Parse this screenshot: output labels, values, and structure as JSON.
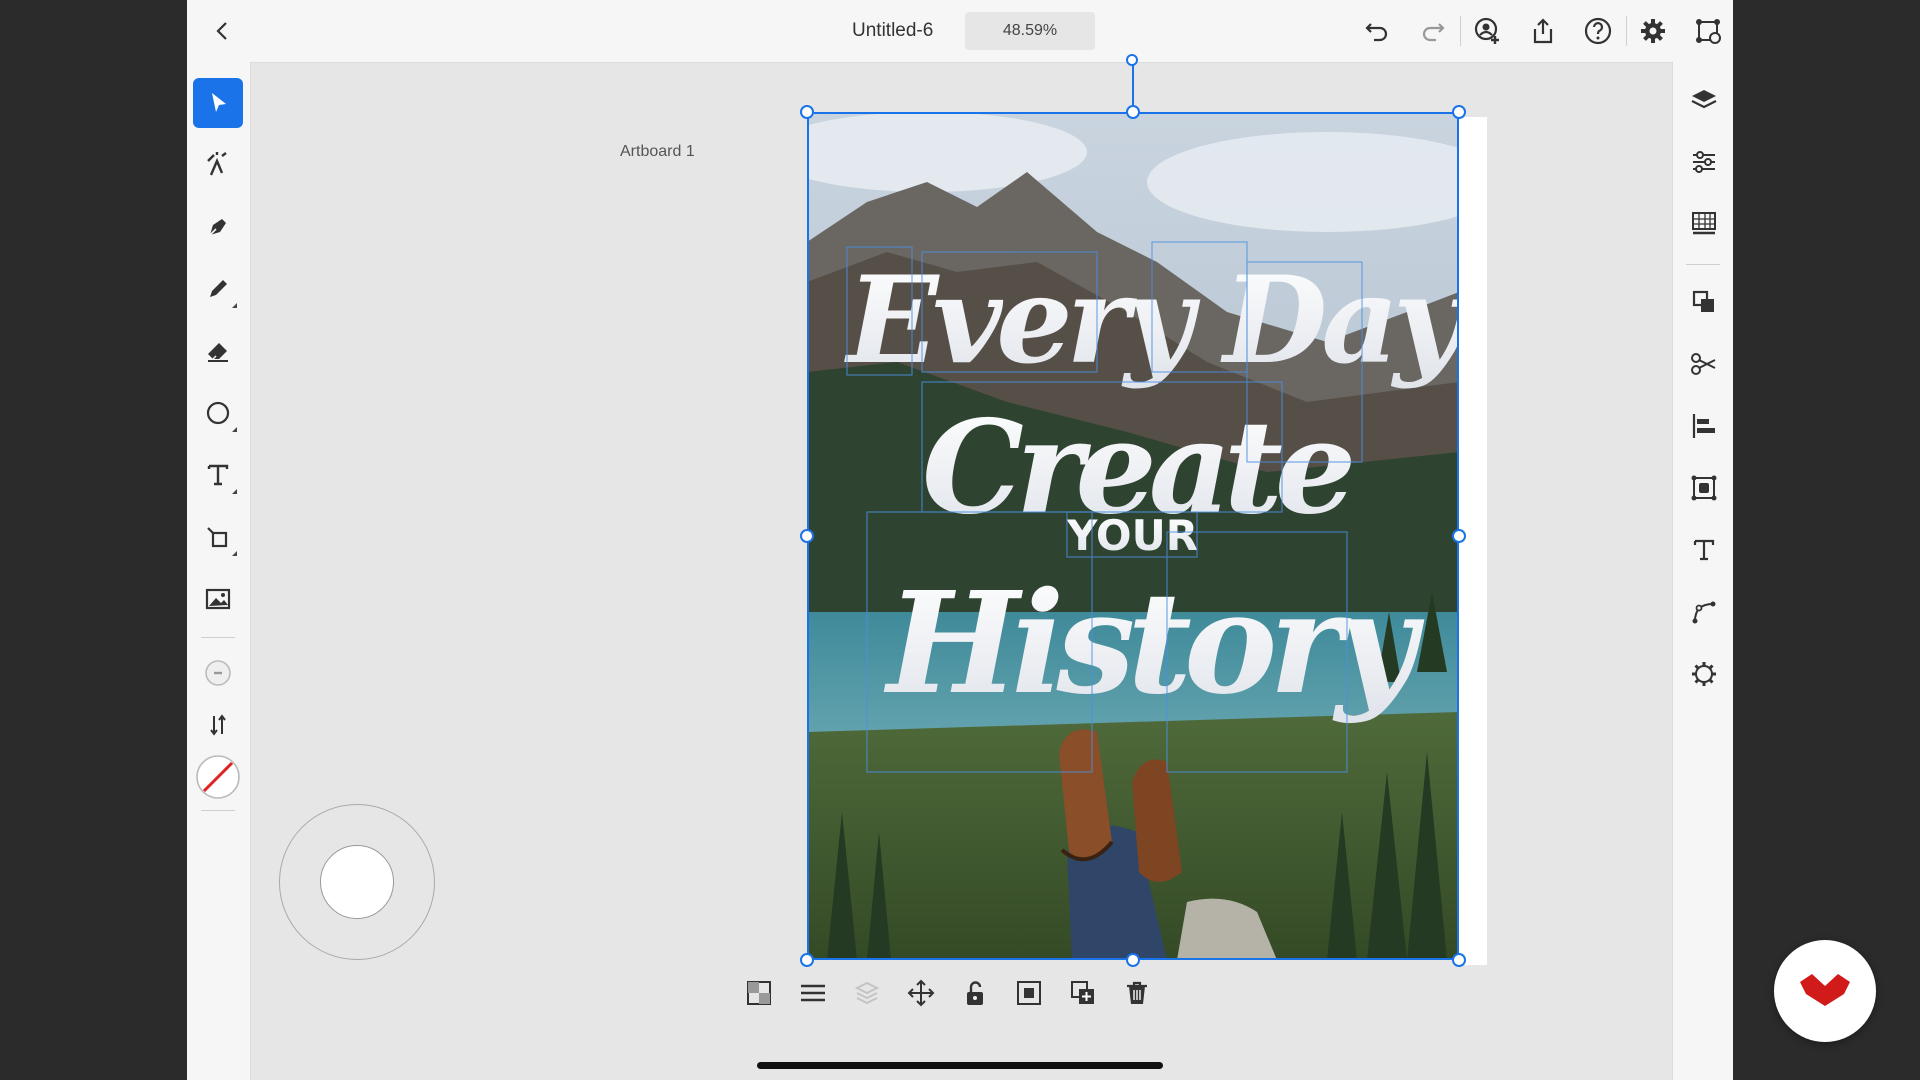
{
  "header": {
    "document_title": "Untitled-6",
    "zoom_level": "48.59%"
  },
  "canvas": {
    "artboard_label": "Artboard 1",
    "artwork_text": {
      "line1": "Every Day",
      "line2": "Create",
      "line3": "YOUR",
      "line4": "History"
    }
  },
  "tools": [
    "select",
    "direct-select",
    "pen",
    "pencil",
    "eraser",
    "shape",
    "text",
    "transform",
    "image",
    "stroke-width",
    "swap-fill-stroke",
    "no-fill"
  ],
  "colors": {
    "accent": "#1a73e8",
    "logo_red": "#d11a1a"
  }
}
